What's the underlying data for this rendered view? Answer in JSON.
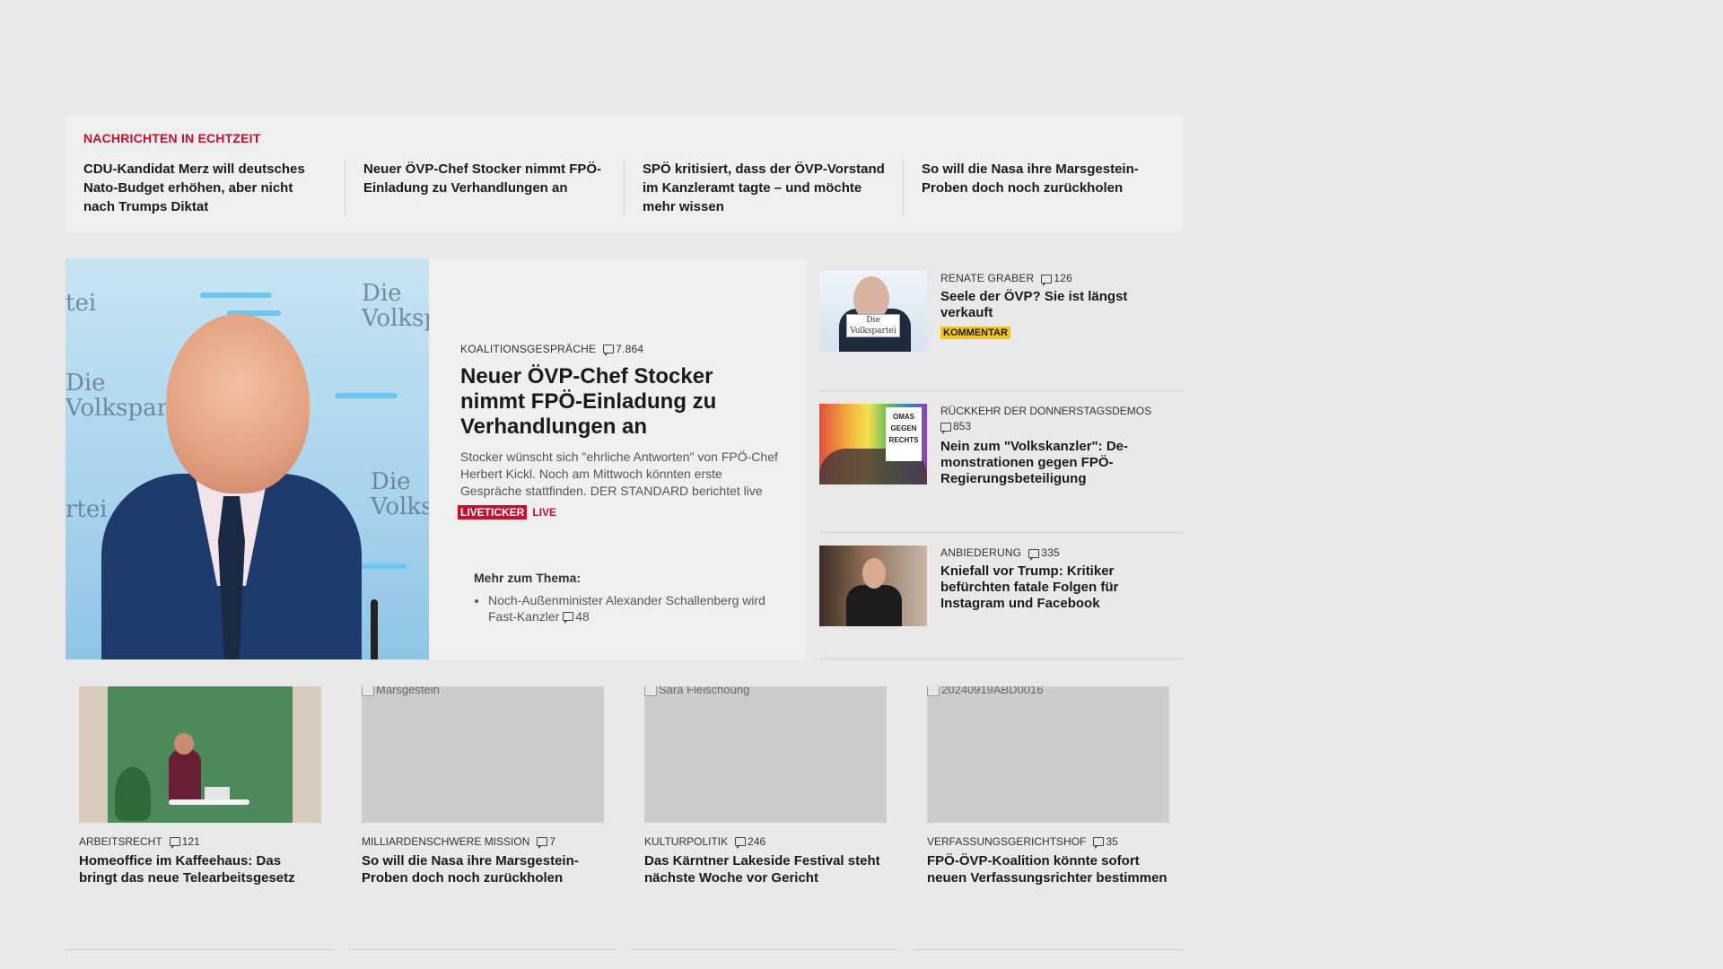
{
  "ticker": {
    "title": "NACHRICHTEN IN ECHTZEIT",
    "items": [
      "CDU-Kandidat Merz will deutsches Nato-Budget erhöhen, aber nicht nach Trumps Diktat",
      "Neuer ÖVP-Chef Stocker nimmt FPÖ-Einladung zu Verhandlungen an",
      "SPÖ kritisiert, dass der ÖVP-Vorstand im Kanzleramt tagte – und möchte mehr wissen",
      "So will die Nasa ihre Marsgestein-Proben doch noch zurückholen"
    ]
  },
  "lead": {
    "image_text": {
      "top_left": "tei",
      "top_right": "Die Volksp",
      "mid_left": "Die Volkspar",
      "bottom_left": "rtei",
      "bottom_right": "Die Volks"
    },
    "kicker": "KOALITIONSGESPRÄCHE",
    "comments": "7.864",
    "title": "Neuer ÖVP-Chef Stocker nimmt FPÖ-Einladung zu Verhandlungen an",
    "description": "Stocker wünscht sich \"ehrliche Antworten\" von FPÖ-Chef Herbert Kickl. Noch am Mittwoch könnten erste Gespräche stattfinden. DER STANDARD berichtet live",
    "badge": "LIVETICKER",
    "live": "LIVE",
    "more_title": "Mehr zum Thema:",
    "more_item": "Noch-Außenminister Alexander Schallenberg wird Fast-Kanzler",
    "more_comments": "48"
  },
  "side": [
    {
      "kicker": "RENATE GRABER",
      "comments": "126",
      "title": "Seele der ÖVP? Sie ist längst verkauft",
      "badge": "KOMMENTAR",
      "thumb_text": "Die Volkspartei"
    },
    {
      "kicker": "RÜCKKEHR DER DONNERSTAGSDEMOS",
      "comments": "853",
      "title": "Nein zum \"Volkskanzler\": De-monstrationen gegen FPÖ-Regierungsbeteiligung",
      "thumb_text": "OMAS GEGEN RECHTS"
    },
    {
      "kicker": "ANBIEDERUNG",
      "comments": "335",
      "title": "Kniefall vor Trump: Kritiker befürchten fatale Folgen für Instagram und Facebook"
    }
  ],
  "cards": [
    {
      "kicker": "ARBEITSRECHT",
      "comments": "121",
      "title": "Homeoffice im Kaffeehaus: Das bringt das neue Telearbeitsgesetz"
    },
    {
      "alt": "Marsgestein",
      "kicker": "MILLIARDENSCHWERE MISSION",
      "comments": "7",
      "title": "So will die Nasa ihre Marsgestein-Proben doch noch zurückholen"
    },
    {
      "alt": "Sara Fleischoung",
      "kicker": "KULTURPOLITIK",
      "comments": "246",
      "title": "Das Kärntner Lakeside Festival steht nächste Woche vor Gericht"
    },
    {
      "alt": "20240919ABD0016",
      "kicker": "VERFASSUNGSGERICHTSHOF",
      "comments": "35",
      "title": "FPÖ-ÖVP-Koalition könnte sofort neuen Verfassungsrichter bestimmen"
    }
  ],
  "colors": {
    "accent": "#c8102e",
    "komm_badge": "#f5c518",
    "background": "#e8e8e8",
    "panel": "#efefef"
  }
}
